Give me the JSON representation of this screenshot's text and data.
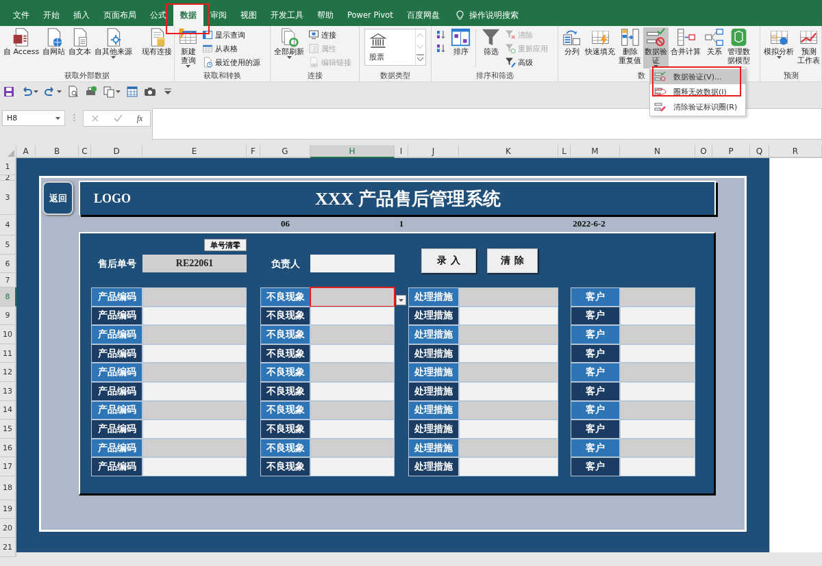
{
  "tabs": [
    {
      "label": "文件",
      "selected": false
    },
    {
      "label": "开始",
      "selected": false
    },
    {
      "label": "插入",
      "selected": false
    },
    {
      "label": "页面布局",
      "selected": false
    },
    {
      "label": "公式",
      "selected": false
    },
    {
      "label": "数据",
      "selected": true
    },
    {
      "label": "审阅",
      "selected": false
    },
    {
      "label": "视图",
      "selected": false
    },
    {
      "label": "开发工具",
      "selected": false
    },
    {
      "label": "帮助",
      "selected": false
    },
    {
      "label": "Power Pivot",
      "selected": false
    },
    {
      "label": "百度网盘",
      "selected": false
    }
  ],
  "search_hint": "操作说明搜索",
  "ribbon": {
    "groups": [
      {
        "label": "获取外部数据",
        "buttons": [
          {
            "kind": "large",
            "lines": [
              "自 Access"
            ],
            "dropdown": false
          },
          {
            "kind": "large",
            "lines": [
              "自网站"
            ],
            "dropdown": false
          },
          {
            "kind": "large",
            "lines": [
              "自文本"
            ],
            "dropdown": false
          },
          {
            "kind": "large",
            "lines": [
              "自其他来源"
            ],
            "dropdown": true
          },
          {
            "kind": "separator"
          },
          {
            "kind": "large",
            "lines": [
              "现有连接"
            ],
            "dropdown": false
          }
        ]
      },
      {
        "label": "获取和转换",
        "buttons": [
          {
            "kind": "large",
            "lines": [
              "新建",
              "查询"
            ],
            "dropdown": true
          },
          {
            "kind": "small",
            "label": "显示查询",
            "dropdown": false
          },
          {
            "kind": "small",
            "label": "从表格",
            "dropdown": false
          },
          {
            "kind": "small",
            "label": "最近使用的源",
            "dropdown": false
          }
        ]
      },
      {
        "label": "连接",
        "buttons": [
          {
            "kind": "large",
            "lines": [
              "全部刷新"
            ],
            "dropdown": true,
            "disabled": false
          },
          {
            "kind": "small",
            "label": "连接",
            "dropdown": false,
            "disabled": false
          },
          {
            "kind": "small",
            "label": "属性",
            "dropdown": false,
            "disabled": true
          },
          {
            "kind": "small",
            "label": "编辑链接",
            "dropdown": false,
            "disabled": true
          }
        ]
      },
      {
        "label": "数据类型",
        "buttons": [
          {
            "kind": "gallery",
            "label": "股票"
          }
        ]
      },
      {
        "label": "排序和筛选",
        "buttons": [
          {
            "kind": "icon",
            "disabled": false
          },
          {
            "kind": "icon",
            "disabled": false
          },
          {
            "kind": "large",
            "lines": [
              "排序"
            ],
            "disabled": false
          },
          {
            "kind": "separator"
          },
          {
            "kind": "large",
            "lines": [
              "筛选"
            ],
            "disabled": false
          },
          {
            "kind": "small",
            "label": "清除",
            "disabled": true
          },
          {
            "kind": "small",
            "label": "重新应用",
            "disabled": true
          },
          {
            "kind": "small",
            "label": "高级",
            "disabled": false
          }
        ]
      },
      {
        "label": "数",
        "buttons": [
          {
            "kind": "large",
            "lines": [
              "分列"
            ],
            "dropdown": false,
            "pressed": false
          },
          {
            "kind": "large",
            "lines": [
              "快速填充"
            ],
            "dropdown": false,
            "pressed": false
          },
          {
            "kind": "large",
            "lines": [
              "删除",
              "重复值"
            ],
            "dropdown": false,
            "pressed": false
          },
          {
            "kind": "large",
            "lines": [
              "数据验",
              "证"
            ],
            "dropdown": true,
            "pressed": true
          },
          {
            "kind": "large",
            "lines": [
              "合并计算"
            ],
            "dropdown": false,
            "pressed": false
          },
          {
            "kind": "large",
            "lines": [
              "关系"
            ],
            "dropdown": false,
            "pressed": false
          },
          {
            "kind": "large",
            "lines": [
              "管理数",
              "据模型"
            ],
            "dropdown": false,
            "pressed": false
          }
        ]
      },
      {
        "label": "预测",
        "buttons": [
          {
            "kind": "large",
            "lines": [
              "模拟分析"
            ],
            "dropdown": true
          },
          {
            "kind": "large",
            "lines": [
              "预测",
              "工作表"
            ],
            "dropdown": false
          }
        ]
      }
    ]
  },
  "menu": {
    "items": [
      {
        "label": "数据验证(V)...",
        "selected": true
      },
      {
        "label": "圈释无效数据(I)",
        "selected": false
      },
      {
        "label": "清除验证标识圈(R)",
        "selected": false
      }
    ]
  },
  "formula_bar": {
    "name_box": "H8",
    "function_label": "fx"
  },
  "columns": [
    {
      "label": "A",
      "selected": false
    },
    {
      "label": "B",
      "selected": false
    },
    {
      "label": "C",
      "selected": false
    },
    {
      "label": "D",
      "selected": false
    },
    {
      "label": "E",
      "selected": false
    },
    {
      "label": "F",
      "selected": false
    },
    {
      "label": "G",
      "selected": false
    },
    {
      "label": "H",
      "selected": true
    },
    {
      "label": "I",
      "selected": false
    },
    {
      "label": "J",
      "selected": false
    },
    {
      "label": "K",
      "selected": false
    },
    {
      "label": "L",
      "selected": false
    },
    {
      "label": "M",
      "selected": false
    },
    {
      "label": "N",
      "selected": false
    },
    {
      "label": "O",
      "selected": false
    },
    {
      "label": "P",
      "selected": false
    },
    {
      "label": "Q",
      "selected": false
    },
    {
      "label": "R",
      "selected": false
    }
  ],
  "rows": [
    {
      "label": "1",
      "selected": false
    },
    {
      "label": "2",
      "selected": false
    },
    {
      "label": "3",
      "selected": false
    },
    {
      "label": "4",
      "selected": false
    },
    {
      "label": "5",
      "selected": false
    },
    {
      "label": "6",
      "selected": false
    },
    {
      "label": "7",
      "selected": false
    },
    {
      "label": "8",
      "selected": true
    },
    {
      "label": "9",
      "selected": false
    },
    {
      "label": "10",
      "selected": false
    },
    {
      "label": "11",
      "selected": false
    },
    {
      "label": "12",
      "selected": false
    },
    {
      "label": "13",
      "selected": false
    },
    {
      "label": "14",
      "selected": false
    },
    {
      "label": "15",
      "selected": false
    },
    {
      "label": "16",
      "selected": false
    },
    {
      "label": "17",
      "selected": false
    },
    {
      "label": "18",
      "selected": false
    },
    {
      "label": "19",
      "selected": false
    },
    {
      "label": "20",
      "selected": false
    },
    {
      "label": "21",
      "selected": false
    }
  ],
  "form": {
    "back_button": "返回",
    "logo": "LOGO",
    "title": "XXX 产品售后管理系统",
    "info": [
      "06",
      "1",
      "2022-6-2"
    ],
    "reset_button": "单号清零",
    "order_label": "售后单号",
    "order_value": "RE22061",
    "owner_label": "负责人",
    "action_buttons": [
      "录入",
      "清除"
    ],
    "records": [
      {
        "shaded": true,
        "cells": [
          {
            "label": "产品编码",
            "selected": false
          },
          {
            "label": "不良现象",
            "selected": true
          },
          {
            "label": "处理措施",
            "selected": false
          },
          {
            "label": "客户",
            "selected": false
          }
        ]
      },
      {
        "shaded": false,
        "cells": [
          {
            "label": "产品编码",
            "selected": false
          },
          {
            "label": "不良现象",
            "selected": false
          },
          {
            "label": "处理措施",
            "selected": false
          },
          {
            "label": "客户",
            "selected": false
          }
        ]
      },
      {
        "shaded": true,
        "cells": [
          {
            "label": "产品编码",
            "selected": false
          },
          {
            "label": "不良现象",
            "selected": false
          },
          {
            "label": "处理措施",
            "selected": false
          },
          {
            "label": "客户",
            "selected": false
          }
        ]
      },
      {
        "shaded": false,
        "cells": [
          {
            "label": "产品编码",
            "selected": false
          },
          {
            "label": "不良现象",
            "selected": false
          },
          {
            "label": "处理措施",
            "selected": false
          },
          {
            "label": "客户",
            "selected": false
          }
        ]
      },
      {
        "shaded": true,
        "cells": [
          {
            "label": "产品编码",
            "selected": false
          },
          {
            "label": "不良现象",
            "selected": false
          },
          {
            "label": "处理措施",
            "selected": false
          },
          {
            "label": "客户",
            "selected": false
          }
        ]
      },
      {
        "shaded": false,
        "cells": [
          {
            "label": "产品编码",
            "selected": false
          },
          {
            "label": "不良现象",
            "selected": false
          },
          {
            "label": "处理措施",
            "selected": false
          },
          {
            "label": "客户",
            "selected": false
          }
        ]
      },
      {
        "shaded": true,
        "cells": [
          {
            "label": "产品编码",
            "selected": false
          },
          {
            "label": "不良现象",
            "selected": false
          },
          {
            "label": "处理措施",
            "selected": false
          },
          {
            "label": "客户",
            "selected": false
          }
        ]
      },
      {
        "shaded": false,
        "cells": [
          {
            "label": "产品编码",
            "selected": false
          },
          {
            "label": "不良现象",
            "selected": false
          },
          {
            "label": "处理措施",
            "selected": false
          },
          {
            "label": "客户",
            "selected": false
          }
        ]
      },
      {
        "shaded": true,
        "cells": [
          {
            "label": "产品编码",
            "selected": false
          },
          {
            "label": "不良现象",
            "selected": false
          },
          {
            "label": "处理措施",
            "selected": false
          },
          {
            "label": "客户",
            "selected": false
          }
        ]
      },
      {
        "shaded": false,
        "cells": [
          {
            "label": "产品编码",
            "selected": false
          },
          {
            "label": "不良现象",
            "selected": false
          },
          {
            "label": "处理措施",
            "selected": false
          },
          {
            "label": "客户",
            "selected": false
          }
        ]
      }
    ]
  }
}
